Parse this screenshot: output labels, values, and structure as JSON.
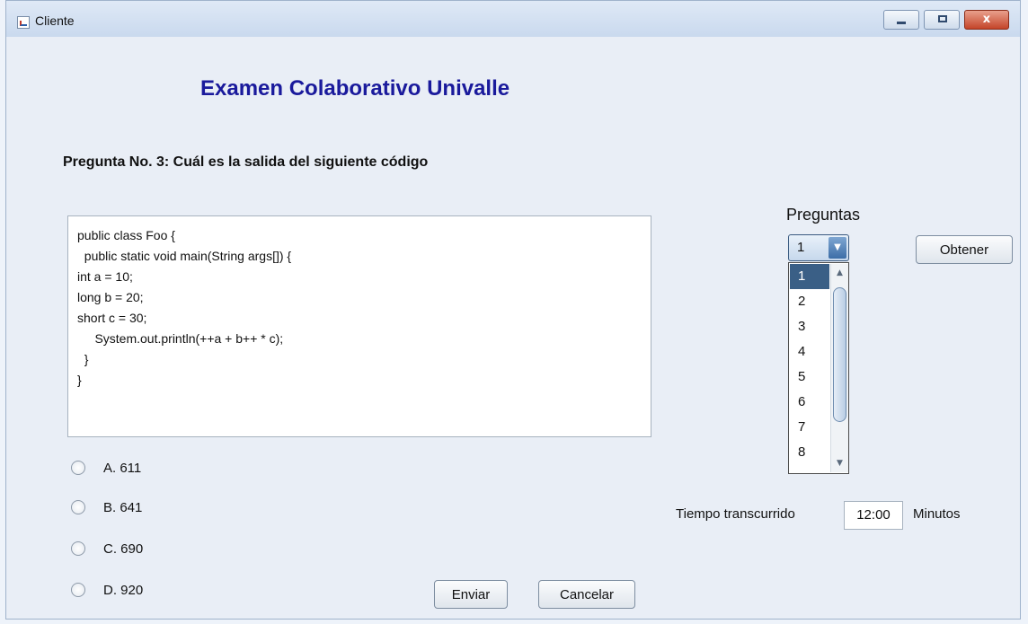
{
  "window": {
    "title": "Cliente",
    "controls": {
      "minimize": "",
      "maximize": "",
      "close": "x"
    }
  },
  "app_title": "Examen Colaborativo Univalle",
  "question": {
    "text": "Pregunta No. 3: Cuál es la salida del siguiente código",
    "code": "public class Foo {\n  public static void main(String args[]) {\nint a = 10;\nlong b = 20;\nshort c = 30;\n     System.out.println(++a + b++ * c);\n  }\n}"
  },
  "options": [
    {
      "label": "A. 611",
      "selected": false
    },
    {
      "label": "B. 641",
      "selected": false
    },
    {
      "label": "C. 690",
      "selected": false
    },
    {
      "label": "D. 920",
      "selected": false
    }
  ],
  "buttons": {
    "enviar": "Enviar",
    "cancelar": "Cancelar",
    "obtener": "Obtener"
  },
  "preguntas": {
    "label": "Preguntas",
    "selected": "1",
    "items": [
      "1",
      "2",
      "3",
      "4",
      "5",
      "6",
      "7",
      "8"
    ]
  },
  "tiempo": {
    "label": "Tiempo transcurrido",
    "value": "12:00",
    "unit": "Minutos"
  }
}
